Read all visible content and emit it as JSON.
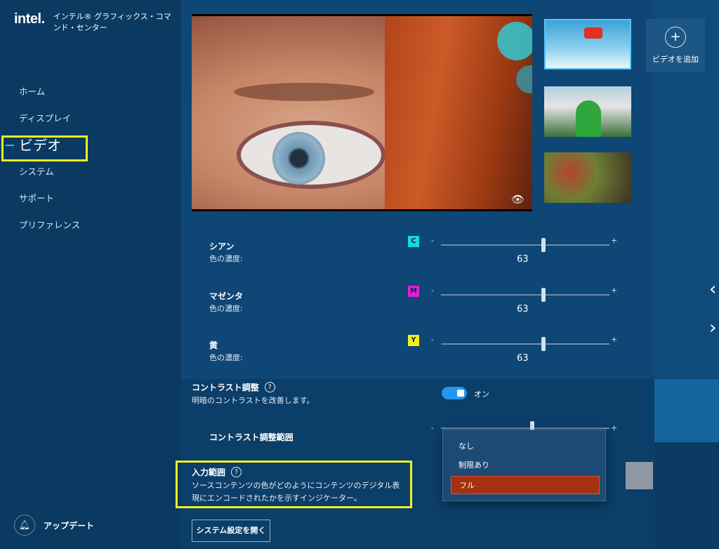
{
  "app": {
    "logo_text": "intel.",
    "title": "インテル® グラフィックス・コマンド・センター"
  },
  "window_controls": {
    "minimize": "—",
    "maximize": "☐",
    "close": "✕"
  },
  "sidebar": {
    "items": [
      {
        "label": "ホーム"
      },
      {
        "label": "ディスプレイ"
      },
      {
        "label": "ビデオ",
        "active": true
      },
      {
        "label": "システム"
      },
      {
        "label": "サポート"
      },
      {
        "label": "プリファレンス"
      }
    ],
    "update_label": "アップデート",
    "update_icon": "bell-icon"
  },
  "video": {
    "add_video_label": "ビデオを追加",
    "add_icon": "plus-icon",
    "thumbnails": [
      "snowboard",
      "people",
      "market"
    ],
    "preview_icon": "eye-icon"
  },
  "color_sliders": [
    {
      "name": "シアン",
      "sub": "色の濃度:",
      "chip": "C",
      "chip_color": "#1ad4e8",
      "minus": "-",
      "plus": "+",
      "value": "63"
    },
    {
      "name": "マゼンタ",
      "sub": "色の濃度:",
      "chip": "M",
      "chip_color": "#e01fd4",
      "minus": "-",
      "plus": "+",
      "value": "63"
    },
    {
      "name": "黄",
      "sub": "色の濃度:",
      "chip": "Y",
      "chip_color": "#f1ef21",
      "minus": "-",
      "plus": "+",
      "value": "63"
    }
  ],
  "contrast": {
    "title": "コントラスト調整",
    "help": "?",
    "description": "明暗のコントラストを改善します。",
    "toggle_label": "オン",
    "toggle_on": true,
    "range_title": "コントラスト調整範囲",
    "minus": "-",
    "plus": "+"
  },
  "input_range": {
    "title": "入力範囲",
    "help": "?",
    "description": "ソースコンテンツの色がどのようにコンテンツのデジタル表現にエンコードされたかを示すインジケーター。",
    "options": [
      "なし",
      "制限あり",
      "フル"
    ],
    "selected": "フル"
  },
  "system_settings_button": "システム設定を開く",
  "nav_arrows": {
    "up": "‹",
    "down": "›"
  },
  "colors": {
    "highlight": "#f2ef1f",
    "accent": "#2196f3",
    "selected_option": "#a4310f"
  }
}
